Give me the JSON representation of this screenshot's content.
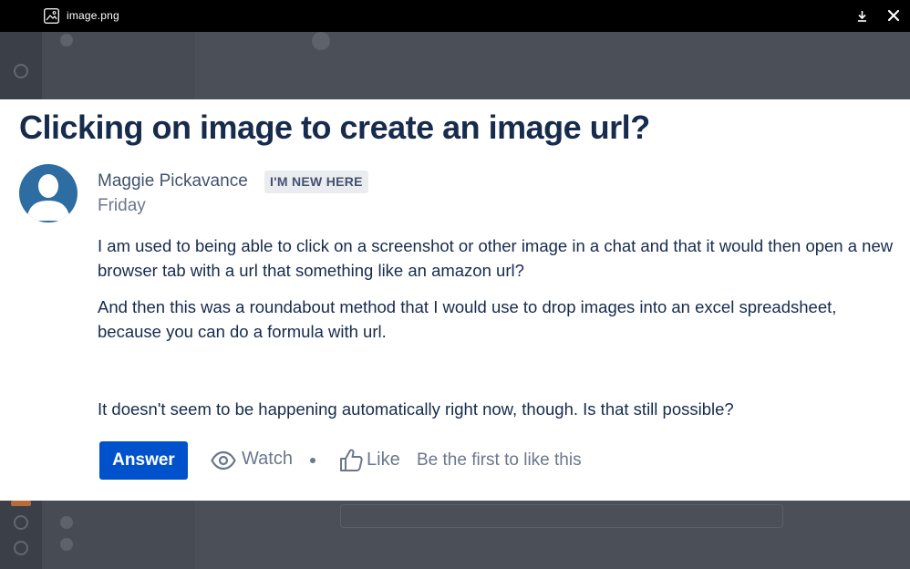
{
  "viewer": {
    "file_name": "image.png",
    "download_icon": "download-icon",
    "close_icon": "close-icon"
  },
  "post": {
    "title": "Clicking on image to create an image url?",
    "author": "Maggie Pickavance",
    "badge": "I'M NEW HERE",
    "date": "Friday",
    "paragraphs": [
      "I am used to being able to click on a screenshot or other image in a chat and that it would then open a new browser tab with a url that something like an amazon url?",
      "And then this was a roundabout method that I would use to drop images into an excel spreadsheet, because you can do a formula with url.",
      "It doesn't seem to be happening automatically right now, though. Is that still possible?"
    ]
  },
  "actions": {
    "answer_label": "Answer",
    "watch_label": "Watch",
    "like_label": "Like",
    "like_info": "Be the first to like this"
  },
  "colors": {
    "title": "#172b4d",
    "primary": "#0052cc",
    "muted": "#6b778c",
    "avatar": "#2d6da2"
  }
}
